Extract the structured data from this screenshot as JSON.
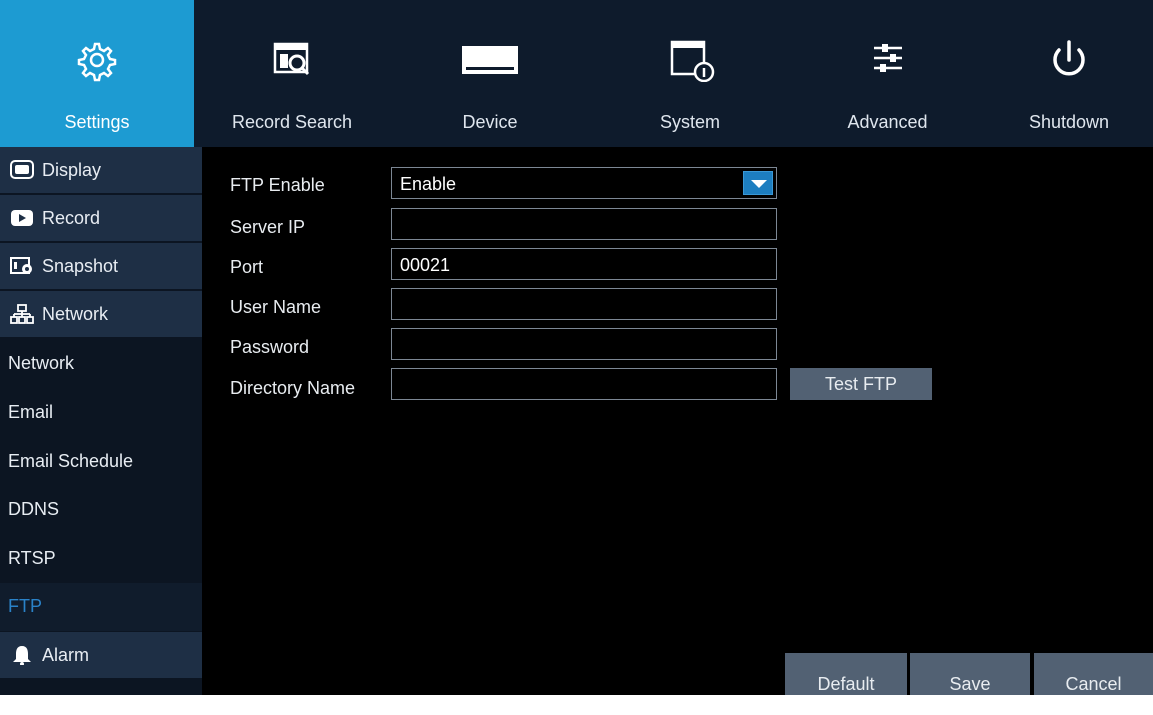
{
  "topnav": {
    "tabs": [
      {
        "label": "Settings",
        "icon": "gear-icon"
      },
      {
        "label": "Record Search",
        "icon": "record-search-icon"
      },
      {
        "label": "Device",
        "icon": "hard-drive-icon"
      },
      {
        "label": "System",
        "icon": "system-info-icon"
      },
      {
        "label": "Advanced",
        "icon": "sliders-icon"
      },
      {
        "label": "Shutdown",
        "icon": "power-icon"
      }
    ]
  },
  "sidebar": {
    "categories": [
      {
        "label": "Display",
        "icon": "monitor-icon"
      },
      {
        "label": "Record",
        "icon": "record-icon"
      },
      {
        "label": "Snapshot",
        "icon": "snapshot-icon"
      },
      {
        "label": "Network",
        "icon": "network-icon"
      },
      {
        "label": "Alarm",
        "icon": "bell-icon"
      }
    ],
    "network_items": [
      "Network",
      "Email",
      "Email Schedule",
      "DDNS",
      "RTSP",
      "FTP"
    ],
    "active_item": "FTP"
  },
  "form": {
    "ftp_enable_label": "FTP Enable",
    "ftp_enable_value": "Enable",
    "server_ip_label": "Server IP",
    "server_ip_value": "",
    "port_label": "Port",
    "port_value": "00021",
    "user_name_label": "User Name",
    "user_name_value": "",
    "password_label": "Password",
    "password_value": "",
    "directory_name_label": "Directory Name",
    "directory_name_value": "",
    "test_ftp_label": "Test FTP"
  },
  "footer": {
    "default_label": "Default",
    "save_label": "Save",
    "cancel_label": "Cancel"
  },
  "colors": {
    "accent": "#1d9bd2",
    "nav_bg": "#0e1b2c",
    "sidebar_category_bg": "#1e2f45",
    "button_bg": "#526173",
    "active_text": "#2a82c8"
  }
}
